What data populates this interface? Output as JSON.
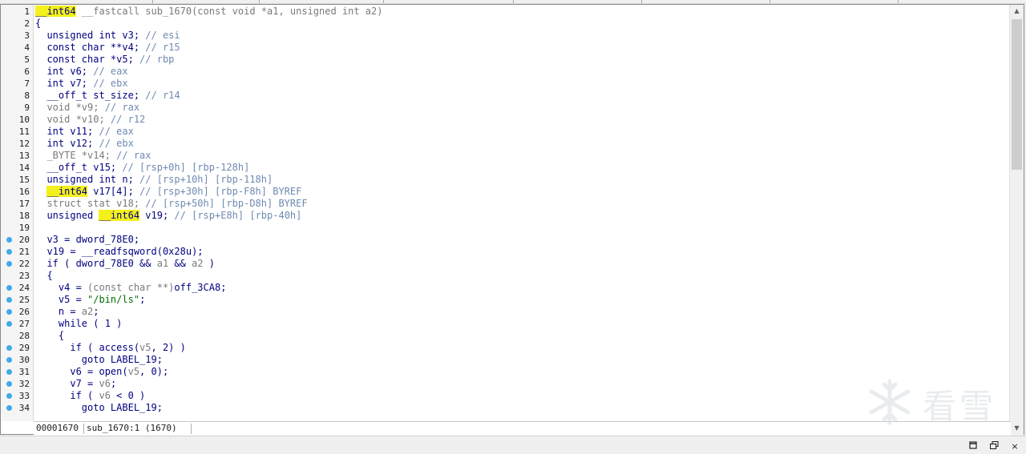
{
  "window": {
    "buttons": {
      "restore_icon": "restore-icon",
      "float_icon": "float-icon",
      "close_label": "×"
    }
  },
  "status": {
    "address": "00001670",
    "location": "sub_1670:1 (1670)"
  },
  "watermark": {
    "text": "看雪"
  },
  "lines": [
    {
      "n": "1",
      "bp": false,
      "tokens": [
        [
          "__int64",
          "hl"
        ],
        [
          " __fastcall sub_1670(const void *a1, unsigned int a2)",
          "gray"
        ]
      ]
    },
    {
      "n": "2",
      "bp": false,
      "tokens": [
        [
          "{",
          "default"
        ]
      ]
    },
    {
      "n": "3",
      "bp": false,
      "tokens": [
        [
          "  unsigned int v3; ",
          "default"
        ],
        [
          "// esi",
          "comment"
        ]
      ]
    },
    {
      "n": "4",
      "bp": false,
      "tokens": [
        [
          "  const char **v4; ",
          "default"
        ],
        [
          "// r15",
          "comment"
        ]
      ]
    },
    {
      "n": "5",
      "bp": false,
      "tokens": [
        [
          "  const char *v5; ",
          "default"
        ],
        [
          "// rbp",
          "comment"
        ]
      ]
    },
    {
      "n": "6",
      "bp": false,
      "tokens": [
        [
          "  int v6; ",
          "default"
        ],
        [
          "// eax",
          "comment"
        ]
      ]
    },
    {
      "n": "7",
      "bp": false,
      "tokens": [
        [
          "  int v7; ",
          "default"
        ],
        [
          "// ebx",
          "comment"
        ]
      ]
    },
    {
      "n": "8",
      "bp": false,
      "tokens": [
        [
          "  __off_t st_size; ",
          "default"
        ],
        [
          "// r14",
          "comment"
        ]
      ]
    },
    {
      "n": "9",
      "bp": false,
      "tokens": [
        [
          "  void *v9; ",
          "gray"
        ],
        [
          "// rax",
          "comment"
        ]
      ]
    },
    {
      "n": "10",
      "bp": false,
      "tokens": [
        [
          "  void *v10; ",
          "gray"
        ],
        [
          "// r12",
          "comment"
        ]
      ]
    },
    {
      "n": "11",
      "bp": false,
      "tokens": [
        [
          "  int v11; ",
          "default"
        ],
        [
          "// eax",
          "comment"
        ]
      ]
    },
    {
      "n": "12",
      "bp": false,
      "tokens": [
        [
          "  int v12; ",
          "default"
        ],
        [
          "// ebx",
          "comment"
        ]
      ]
    },
    {
      "n": "13",
      "bp": false,
      "tokens": [
        [
          "  _BYTE *v14; ",
          "gray"
        ],
        [
          "// rax",
          "comment"
        ]
      ]
    },
    {
      "n": "14",
      "bp": false,
      "tokens": [
        [
          "  __off_t v15; ",
          "default"
        ],
        [
          "// [rsp+0h] [rbp-128h]",
          "comment"
        ]
      ]
    },
    {
      "n": "15",
      "bp": false,
      "tokens": [
        [
          "  unsigned int n; ",
          "default"
        ],
        [
          "// [rsp+10h] [rbp-118h]",
          "comment"
        ]
      ]
    },
    {
      "n": "16",
      "bp": false,
      "tokens": [
        [
          "  ",
          "default"
        ],
        [
          "__int64",
          "hl"
        ],
        [
          " v17[4]; ",
          "default"
        ],
        [
          "// [rsp+30h] [rbp-F8h] BYREF",
          "comment"
        ]
      ]
    },
    {
      "n": "17",
      "bp": false,
      "tokens": [
        [
          "  struct stat v18; ",
          "gray"
        ],
        [
          "// [rsp+50h] [rbp-D8h] BYREF",
          "comment"
        ]
      ]
    },
    {
      "n": "18",
      "bp": false,
      "tokens": [
        [
          "  unsigned ",
          "default"
        ],
        [
          "__int64",
          "hl"
        ],
        [
          " v19; ",
          "default"
        ],
        [
          "// [rsp+E8h] [rbp-40h]",
          "comment"
        ]
      ]
    },
    {
      "n": "19",
      "bp": false,
      "tokens": [
        [
          "",
          "default"
        ]
      ]
    },
    {
      "n": "20",
      "bp": true,
      "tokens": [
        [
          "  v3 = dword_78E0;",
          "default"
        ]
      ]
    },
    {
      "n": "21",
      "bp": true,
      "tokens": [
        [
          "  v19 = __readfsqword(0x28u);",
          "default"
        ]
      ]
    },
    {
      "n": "22",
      "bp": true,
      "tokens": [
        [
          "  if ( dword_78E0 && ",
          "default"
        ],
        [
          "a1",
          "gray"
        ],
        [
          " && ",
          "default"
        ],
        [
          "a2",
          "gray"
        ],
        [
          " )",
          "default"
        ]
      ]
    },
    {
      "n": "23",
      "bp": false,
      "tokens": [
        [
          "  {",
          "default"
        ]
      ]
    },
    {
      "n": "24",
      "bp": true,
      "tokens": [
        [
          "    v4 = ",
          "default"
        ],
        [
          "(const char **)",
          "gray"
        ],
        [
          "off_3CA8;",
          "default"
        ]
      ]
    },
    {
      "n": "25",
      "bp": true,
      "tokens": [
        [
          "    v5 = ",
          "default"
        ],
        [
          "\"/bin/ls\"",
          "green"
        ],
        [
          ";",
          "default"
        ]
      ]
    },
    {
      "n": "26",
      "bp": true,
      "tokens": [
        [
          "    n = ",
          "default"
        ],
        [
          "a2",
          "gray"
        ],
        [
          ";",
          "default"
        ]
      ]
    },
    {
      "n": "27",
      "bp": true,
      "tokens": [
        [
          "    while ( 1 )",
          "default"
        ]
      ]
    },
    {
      "n": "28",
      "bp": false,
      "tokens": [
        [
          "    {",
          "default"
        ]
      ]
    },
    {
      "n": "29",
      "bp": true,
      "tokens": [
        [
          "      if ( access(",
          "default"
        ],
        [
          "v5",
          "gray"
        ],
        [
          ", 2) )",
          "default"
        ]
      ]
    },
    {
      "n": "30",
      "bp": true,
      "tokens": [
        [
          "        goto LABEL_19;",
          "default"
        ]
      ]
    },
    {
      "n": "31",
      "bp": true,
      "tokens": [
        [
          "      v6 = open(",
          "default"
        ],
        [
          "v5",
          "gray"
        ],
        [
          ", 0);",
          "default"
        ]
      ]
    },
    {
      "n": "32",
      "bp": true,
      "tokens": [
        [
          "      v7 = ",
          "default"
        ],
        [
          "v6",
          "gray"
        ],
        [
          ";",
          "default"
        ]
      ]
    },
    {
      "n": "33",
      "bp": true,
      "tokens": [
        [
          "      if ( ",
          "default"
        ],
        [
          "v6",
          "gray"
        ],
        [
          " < 0 )",
          "default"
        ]
      ]
    },
    {
      "n": "34",
      "bp": true,
      "tokens": [
        [
          "        goto LABEL_19;",
          "default"
        ]
      ]
    }
  ]
}
